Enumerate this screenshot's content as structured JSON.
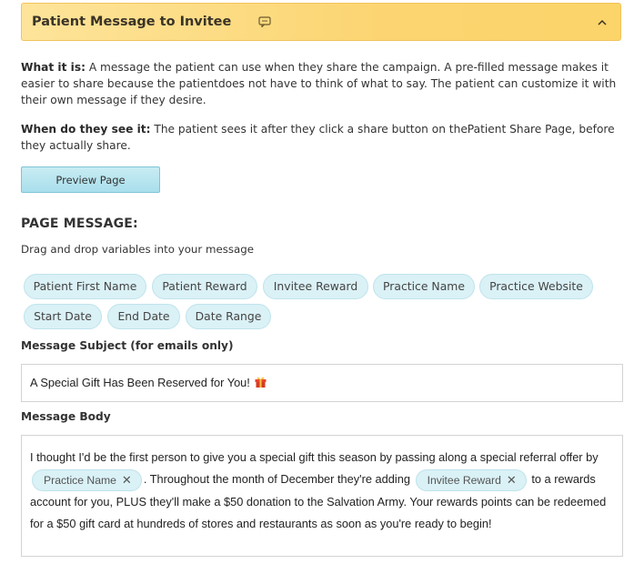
{
  "header": {
    "title": "Patient Message to Invitee",
    "icon": "message-icon",
    "toggle_icon": "chevron-up-icon"
  },
  "what_it_is": {
    "label": "What it is:",
    "text": " A message the patient can use when they share the campaign. A pre-filled message makes it easier to share because the patientdoes not have to think of what to say. The patient can customize it with their own message if they desire."
  },
  "when_see": {
    "label": "When do they see it:",
    "text": " The patient sees it after they click a share button on thePatient Share Page, before they actually share."
  },
  "preview_button": "Preview Page",
  "page_message": {
    "title": "PAGE MESSAGE:",
    "hint": "Drag and drop variables into your message",
    "variables": [
      "Patient First Name",
      "Patient Reward",
      "Invitee Reward",
      "Practice Name",
      "Practice Website",
      "Start Date",
      "End Date",
      "Date Range"
    ]
  },
  "subject": {
    "label": "Message Subject (for emails only)",
    "value": "A Special Gift Has Been Reserved for You!"
  },
  "body": {
    "label": "Message Body",
    "part1": "I thought I'd be the first person to give you a special gift this season by passing along a special referral offer by",
    "chip1": "Practice Name",
    "part2": ". Throughout the month of December they're adding",
    "chip2": "Invitee Reward",
    "part3": "to a rewards account for you, PLUS they'll make a $50 donation to the Salvation Army. Your rewards points can be redeemed for a $50 gift card at hundreds of stores and restaurants as soon as you're ready to begin!"
  },
  "colors": {
    "header_bg": "#fcd572",
    "chip_bg": "#daf1f6",
    "button_bg": "#a9dfec"
  }
}
